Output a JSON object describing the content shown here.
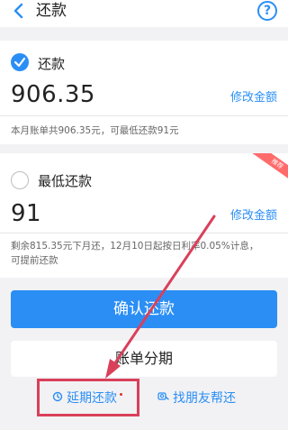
{
  "header": {
    "title": "还款",
    "help_label": "?"
  },
  "repay_full": {
    "label": "还款",
    "amount": "906.35",
    "modify_label": "修改金额",
    "note": "本月账单共906.35元，可最低还款91元",
    "selected": true
  },
  "repay_min": {
    "label": "最低还款",
    "badge": "推荐",
    "amount": "91",
    "modify_label": "修改金额",
    "note_line1": "剩余815.35元下月还，12月10日起按日利率0.05%计息，",
    "note_line2": "可提前还款",
    "selected": false
  },
  "actions": {
    "confirm_label": "确认还款",
    "installment_label": "账单分期",
    "defer_label": "延期还款",
    "friend_label": "找朋友帮还"
  },
  "colors": {
    "accent": "#2a8ef5",
    "annotation": "#d9405a",
    "badge": "#ff6b6b"
  },
  "icons": {
    "back": "chevron-left-icon",
    "help": "question-circle-icon",
    "check_on": "check-circle-icon",
    "check_off": "empty-circle-icon",
    "defer": "clock-refresh-icon",
    "friend": "friend-icon"
  }
}
